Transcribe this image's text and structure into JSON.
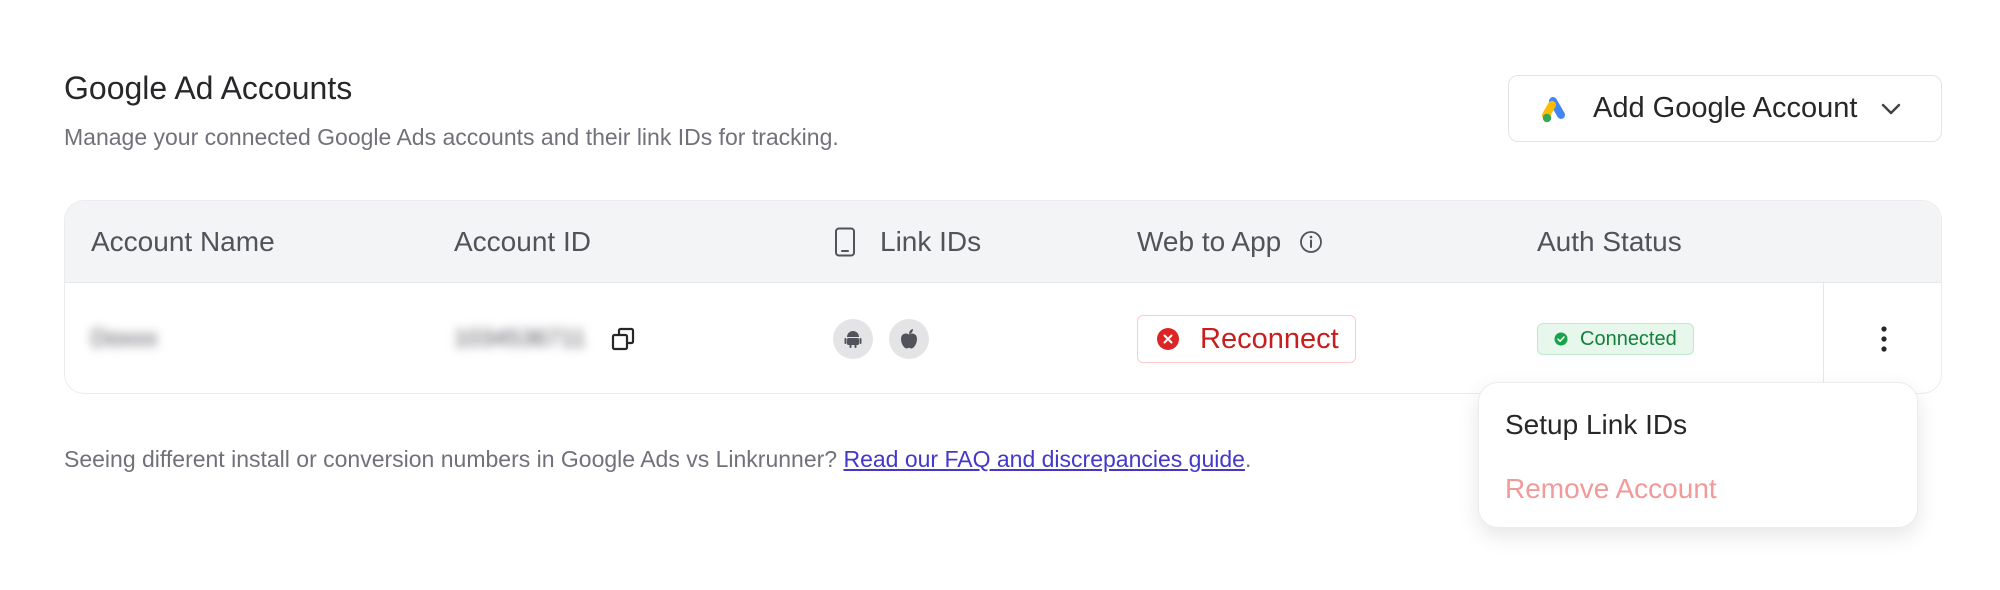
{
  "header": {
    "title": "Google Ad Accounts",
    "subtitle": "Manage your connected Google Ads accounts and their link IDs for tracking."
  },
  "add_button": {
    "label": "Add Google Account",
    "icon": "google-ads-icon"
  },
  "table": {
    "columns": [
      "Account Name",
      "Account ID",
      "Link IDs",
      "Web to App",
      "Auth Status"
    ],
    "rows": [
      {
        "account_name": "Doxxx",
        "account_id": "1034536711",
        "link_ids": [
          "android",
          "apple"
        ],
        "web_to_app": "Reconnect",
        "auth_status": "Connected"
      }
    ]
  },
  "menu": {
    "items": [
      "Setup Link IDs",
      "Remove Account"
    ]
  },
  "footer": {
    "text": "Seeing different install or conversion numbers in Google Ads vs Linkrunner?",
    "link": "Read our FAQ and discrepancies guide",
    "suffix": "."
  },
  "colors": {
    "danger": "#c81e1e",
    "success": "#15803d",
    "link": "#4338ca",
    "header_bg": "#f3f4f6"
  }
}
